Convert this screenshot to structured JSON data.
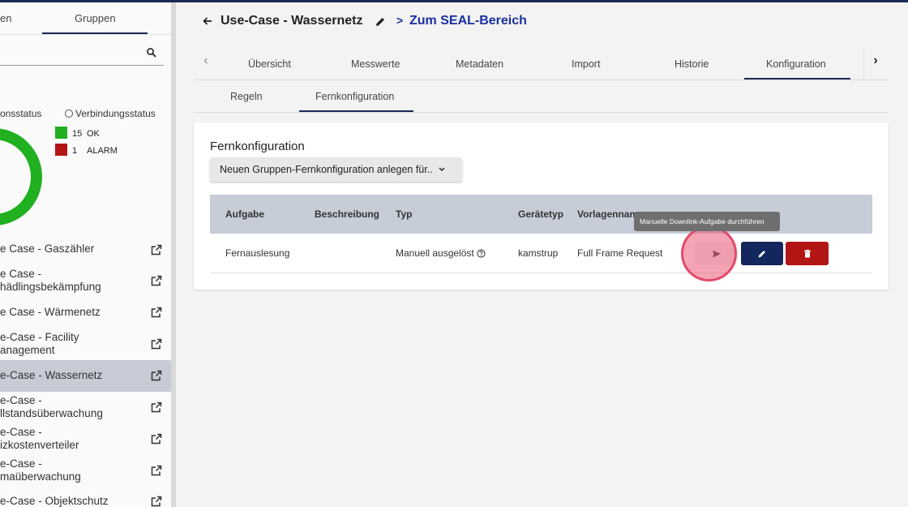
{
  "sidebar": {
    "tabs": [
      "en",
      "Gruppen"
    ],
    "status_options": [
      "onsstatus",
      "Verbindungsstatus"
    ],
    "legend": [
      {
        "count": "15",
        "label": "OK",
        "color": "#20b020"
      },
      {
        "count": "1",
        "label": "ALARM",
        "color": "#b31515"
      }
    ],
    "items": [
      {
        "line1": "e Case - Gaszähler",
        "line2": ""
      },
      {
        "line1": "e Case -",
        "line2": "hädlingsbekämpfung"
      },
      {
        "line1": "e Case - Wärmenetz",
        "line2": ""
      },
      {
        "line1": "e-Case - Facility",
        "line2": "anagement"
      },
      {
        "line1": "e-Case - Wassernetz",
        "line2": ""
      },
      {
        "line1": "e-Case -",
        "line2": "llstandsüberwachung"
      },
      {
        "line1": "e-Case -",
        "line2": "izkostenverteiler"
      },
      {
        "line1": "e-Case -",
        "line2": "maüberwachung"
      },
      {
        "line1": "e-Case - Objektschutz",
        "line2": ""
      }
    ],
    "active_index": 4
  },
  "header": {
    "title": "Use-Case - Wassernetz",
    "link_chevron": ">",
    "link": "Zum SEAL-Bereich"
  },
  "tabs": [
    "Übersicht",
    "Messwerte",
    "Metadaten",
    "Import",
    "Historie",
    "Konfiguration"
  ],
  "active_tab": "Konfiguration",
  "subtabs": [
    "Regeln",
    "Fernkonfiguration"
  ],
  "active_subtab": "Fernkonfiguration",
  "card": {
    "title": "Fernkonfiguration",
    "dropdown_label": "Neuen Gruppen-Fernkonfiguration anlegen für..",
    "columns": [
      "Aufgabe",
      "Beschreibung",
      "Typ",
      "Gerätetyp",
      "Vorlagenname"
    ],
    "rows": [
      {
        "aufgabe": "Fernauslesung",
        "beschreibung": "",
        "typ": "Manuell ausgelöst",
        "geraetetyp": "kamstrup",
        "vorlagenname": "Full Frame Request"
      }
    ],
    "tooltip": "Manuelle Downlink-Aufgabe durchführen"
  },
  "colors": {
    "accent": "#1b2a55",
    "link": "#1a2fa0",
    "danger": "#b31515",
    "ok": "#20b020"
  }
}
